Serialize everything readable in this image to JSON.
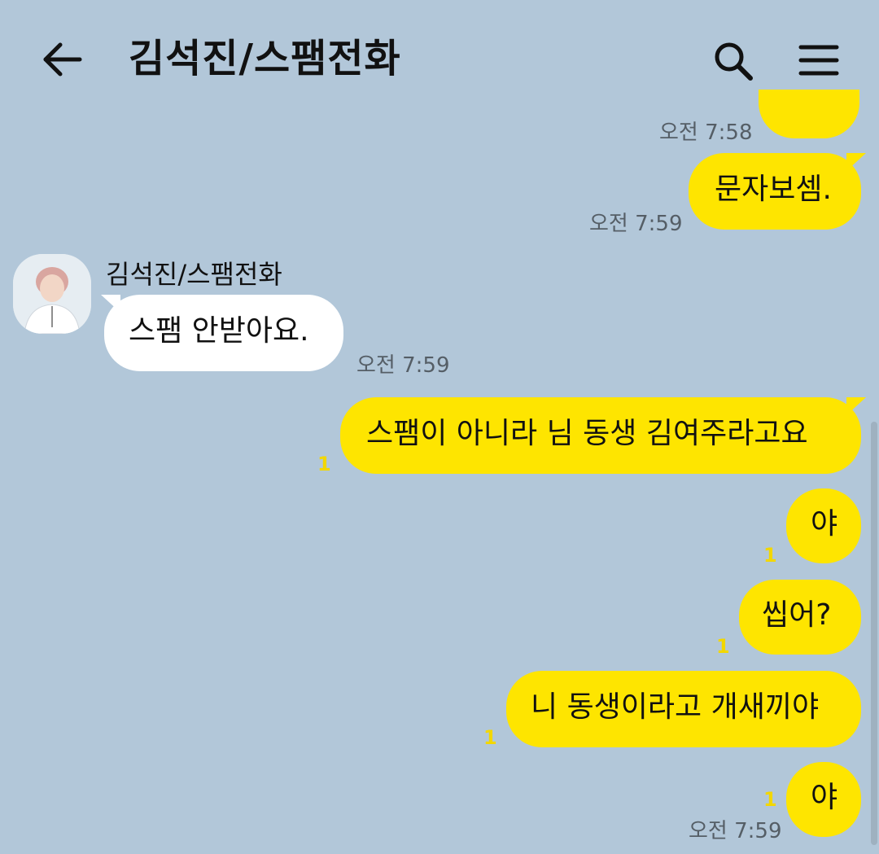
{
  "header": {
    "title": "김석진/스팸전화",
    "back_icon": "arrow-left-icon",
    "search_icon": "search-icon",
    "menu_icon": "hamburger-menu-icon"
  },
  "colors": {
    "background": "#b2c7d9",
    "my_bubble": "#fee500",
    "other_bubble": "#ffffff",
    "unread": "#f2d700"
  },
  "chat": {
    "messages": [
      {
        "from": "me",
        "text": "",
        "time": "오전 7:58"
      },
      {
        "from": "me",
        "text": "문자보셈.",
        "time": "오전 7:59"
      },
      {
        "from": "other",
        "sender": "김석진/스팸전화",
        "text": "스팸 안받아요.",
        "time": "오전 7:59"
      },
      {
        "from": "me",
        "text": "스팸이 아니라 님 동생 김여주라고요",
        "unread": "1"
      },
      {
        "from": "me",
        "text": "야",
        "unread": "1"
      },
      {
        "from": "me",
        "text": "씹어?",
        "unread": "1"
      },
      {
        "from": "me",
        "text": "니 동생이라고 개새끼야",
        "unread": "1"
      },
      {
        "from": "me",
        "text": "야",
        "unread": "1",
        "time": "오전 7:59"
      }
    ]
  }
}
